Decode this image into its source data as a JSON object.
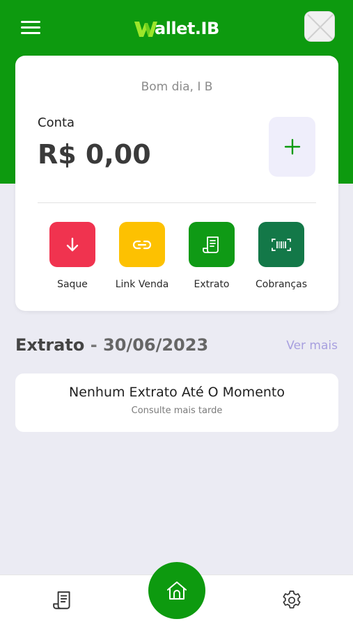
{
  "app": {
    "logo_text": "allet.IB"
  },
  "colors": {
    "brand_green": "#0d9a0f",
    "saque": "#f0334f",
    "link_venda": "#fdc101",
    "extrato": "#0f9a15",
    "cobrancas": "#137848",
    "ver_mais": "#a79fdf"
  },
  "header": {
    "menu_icon": "hamburger-menu-icon",
    "avatar_icon": "user-avatar-placeholder"
  },
  "account": {
    "greeting": "Bom dia, I B",
    "label": "Conta",
    "balance": "R$ 0,00",
    "add_icon": "plus-icon"
  },
  "actions": [
    {
      "label": "Saque",
      "icon": "arrow-down-icon"
    },
    {
      "label": "Link Venda",
      "icon": "link-icon"
    },
    {
      "label": "Extrato",
      "icon": "receipt-icon"
    },
    {
      "label": "Cobranças",
      "icon": "barcode-icon"
    }
  ],
  "statement": {
    "title": "Extrato",
    "separator": "-",
    "date": "30/06/2023",
    "more_link": "Ver mais",
    "empty_title": "Nenhum Extrato Até O Momento",
    "empty_subtitle": "Consulte mais tarde"
  },
  "bottom_nav": [
    {
      "icon": "receipt-icon"
    },
    {
      "icon": "home-icon"
    },
    {
      "icon": "gear-icon"
    }
  ]
}
